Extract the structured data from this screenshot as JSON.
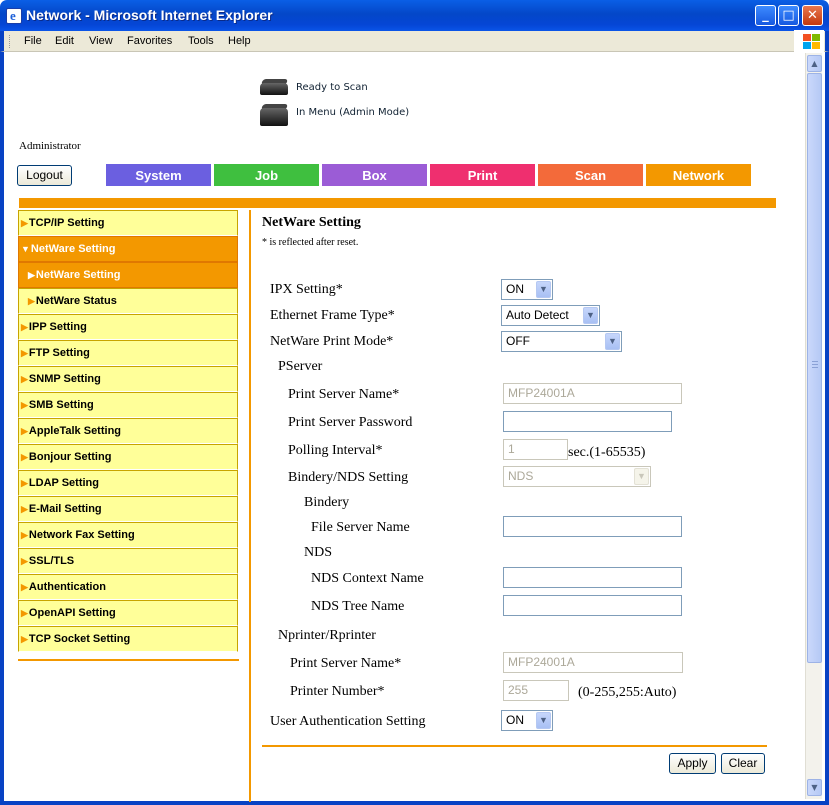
{
  "window": {
    "title": "Network - Microsoft Internet Explorer"
  },
  "menu": [
    "File",
    "Edit",
    "View",
    "Favorites",
    "Tools",
    "Help"
  ],
  "status": {
    "scan": "Ready to Scan",
    "menu": "In Menu (Admin Mode)"
  },
  "user": {
    "role": "Administrator",
    "logout": "Logout"
  },
  "tabs": [
    {
      "label": "System",
      "color": "#6b5fe0"
    },
    {
      "label": "Job",
      "color": "#3fbf3f"
    },
    {
      "label": "Box",
      "color": "#9b5cd6"
    },
    {
      "label": "Print",
      "color": "#ef2f6f"
    },
    {
      "label": "Scan",
      "color": "#f36a3a"
    },
    {
      "label": "Network",
      "color": "#f39800"
    }
  ],
  "sidenav": [
    "TCP/IP Setting",
    "NetWare Setting",
    "NetWare Setting",
    "NetWare Status",
    "IPP Setting",
    "FTP Setting",
    "SNMP Setting",
    "SMB Setting",
    "AppleTalk Setting",
    "Bonjour Setting",
    "LDAP Setting",
    "E-Mail Setting",
    "Network Fax Setting",
    "SSL/TLS",
    "Authentication",
    "OpenAPI Setting",
    "TCP Socket Setting"
  ],
  "form": {
    "title": "NetWare Setting",
    "note": "* is reflected after reset.",
    "ipx_label": "IPX Setting*",
    "ipx_value": "ON",
    "frame_label": "Ethernet Frame Type*",
    "frame_value": "Auto Detect",
    "print_mode_label": "NetWare Print Mode*",
    "print_mode_value": "OFF",
    "pserver_label": "PServer",
    "ps_name_label": "Print Server Name*",
    "ps_name_value": "MFP24001A",
    "ps_password_label": "Print Server Password",
    "ps_password_value": "",
    "polling_label": "Polling Interval*",
    "polling_value": "1",
    "polling_unit": "sec.(1-65535)",
    "bindery_nds_label": "Bindery/NDS Setting",
    "bindery_nds_value": "NDS",
    "bindery_label": "Bindery",
    "file_server_label": "File Server Name",
    "file_server_value": "",
    "nds_label": "NDS",
    "nds_context_label": "NDS Context Name",
    "nds_context_value": "",
    "nds_tree_label": "NDS Tree Name",
    "nds_tree_value": "",
    "nprinter_label": "Nprinter/Rprinter",
    "np_server_label": "Print Server Name*",
    "np_server_value": "MFP24001A",
    "printer_number_label": "Printer Number*",
    "printer_number_value": "255",
    "printer_number_hint": "(0-255,255:Auto)",
    "user_auth_label": "User Authentication Setting",
    "user_auth_value": "ON",
    "apply": "Apply",
    "clear": "Clear"
  }
}
